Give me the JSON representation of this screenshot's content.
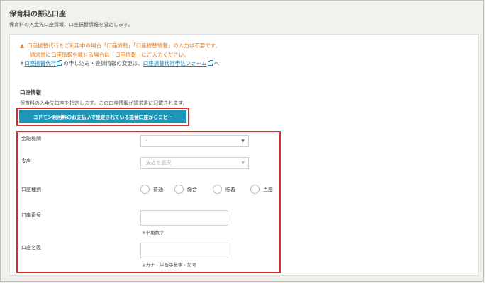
{
  "page": {
    "title": "保育料の振込口座",
    "subtitle": "保育料の入金先口座情報、口座振替情報を設定します。"
  },
  "notice": {
    "warn_icon": "▲",
    "warning_line1": "口座振替代行をご利用中の場合「口座情報」「口座振替情報」の入力は不要です。",
    "warning_line2": "請求書に口座情報を載せる場合は「口座情報」にご入力ください。",
    "info_prefix": "※",
    "info_link1": "口座振替代行",
    "info_middle": "の申し込み・登録情報の変更は、",
    "info_link2": "口座振替代行申込フォーム",
    "info_suffix": "へ"
  },
  "account_section": {
    "title": "口座情報",
    "description": "保育料の入金先口座を指定します。この口座情報が請求書に記載されます。",
    "copy_button_label": "コドモン利用料のお支払いで設定されている振替口座からコピー"
  },
  "form": {
    "bank": {
      "label": "金融機関",
      "value": "-",
      "caret": "▼"
    },
    "branch": {
      "label": "支店",
      "placeholder": "支店を選択",
      "caret": "▼"
    },
    "account_type": {
      "label": "口座種別",
      "options": [
        "普通",
        "総合",
        "貯蓄",
        "当座"
      ]
    },
    "account_number": {
      "label": "口座番号",
      "value": "",
      "hint": "※半角数字"
    },
    "account_name": {
      "label": "口座名義",
      "value": "",
      "hint": "※カナ・半角英数字・記号"
    }
  },
  "colors": {
    "accent_button": "#1d97b8",
    "warning_text": "#e67e22",
    "highlight_border": "#d62c2c",
    "link": "#1b7fb5"
  }
}
